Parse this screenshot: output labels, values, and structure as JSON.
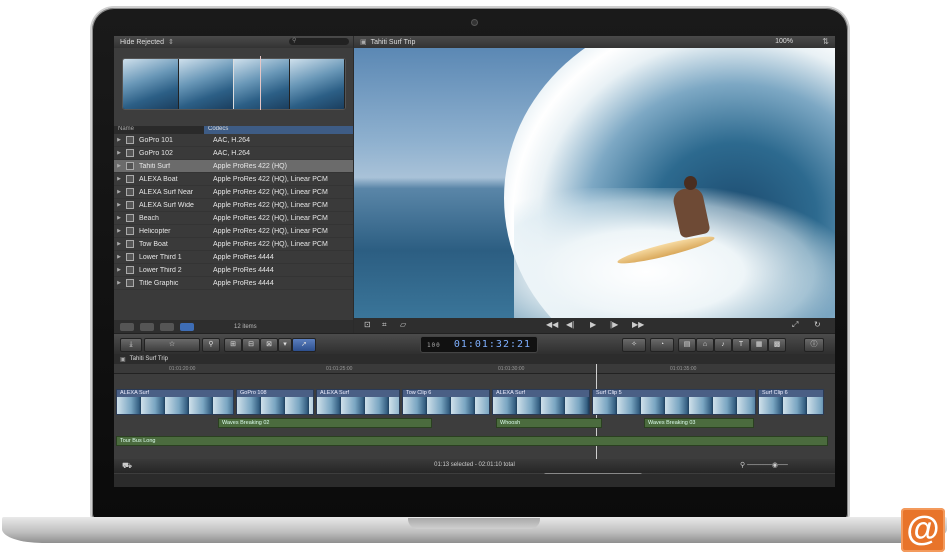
{
  "browser": {
    "filter_label": "Hide Rejected",
    "search_placeholder": "",
    "columns": {
      "name": "Name",
      "codecs": "Codecs"
    },
    "rows": [
      {
        "name": "GoPro 101",
        "codec": "AAC, H.264",
        "selected": false
      },
      {
        "name": "GoPro 102",
        "codec": "AAC, H.264",
        "selected": false
      },
      {
        "name": "Tahiti Surf",
        "codec": "Apple ProRes 422 (HQ)",
        "selected": true
      },
      {
        "name": "ALEXA Boat",
        "codec": "Apple ProRes 422 (HQ), Linear PCM",
        "selected": false
      },
      {
        "name": "ALEXA Surf Near",
        "codec": "Apple ProRes 422 (HQ), Linear PCM",
        "selected": false
      },
      {
        "name": "ALEXA Surf Wide",
        "codec": "Apple ProRes 422 (HQ), Linear PCM",
        "selected": false
      },
      {
        "name": "Beach",
        "codec": "Apple ProRes 422 (HQ), Linear PCM",
        "selected": false
      },
      {
        "name": "Helicopter",
        "codec": "Apple ProRes 422 (HQ), Linear PCM",
        "selected": false
      },
      {
        "name": "Tow Boat",
        "codec": "Apple ProRes 422 (HQ), Linear PCM",
        "selected": false
      },
      {
        "name": "Lower Third 1",
        "codec": "Apple ProRes 4444",
        "selected": false
      },
      {
        "name": "Lower Third 2",
        "codec": "Apple ProRes 4444",
        "selected": false
      },
      {
        "name": "Title Graphic",
        "codec": "Apple ProRes 4444",
        "selected": false
      }
    ],
    "item_count": "12 items"
  },
  "viewer": {
    "title": "Tahiti Surf Trip",
    "zoom": "100%"
  },
  "toolbar": {
    "timecode": "01:01:32:21",
    "timecode_prefix": "100"
  },
  "timeline": {
    "project_title": "Tahiti Surf Trip",
    "ruler_marks": [
      "01:01:20:00",
      "01:01:25:00",
      "01:01:30:00",
      "01:01:35:00"
    ],
    "video_clips": [
      {
        "label": "ALEXA Surf"
      },
      {
        "label": "GoPro 108"
      },
      {
        "label": "ALEXA Surf"
      },
      {
        "label": "Tow Clip 6"
      },
      {
        "label": "ALEXA Surf"
      },
      {
        "label": "Surf Clip 5"
      },
      {
        "label": "Surf Clip 6"
      }
    ],
    "audio_clips": [
      {
        "label": "Waves Breaking 02"
      },
      {
        "label": "Whoosh"
      },
      {
        "label": "Waves Breaking 03"
      },
      {
        "label": "Tour Bus Long"
      }
    ],
    "status": "01:13 selected - 02:01:10 total"
  }
}
